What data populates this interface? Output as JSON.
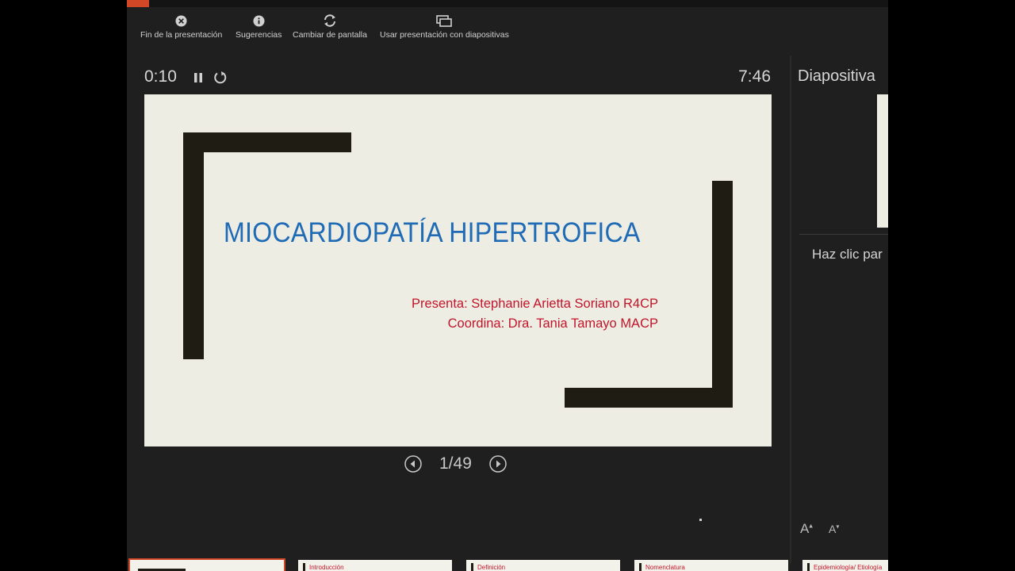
{
  "toolbar": {
    "end": "Fin de la presentación",
    "tips": "Sugerencias",
    "switch": "Cambiar de pantalla",
    "use_slideshow": "Usar presentación con diapositivas"
  },
  "timer": {
    "elapsed": "0:10",
    "clock": "7:46"
  },
  "slide": {
    "title": "MIOCARDIOPATÍA HIPERTROFICA",
    "presenter": "Presenta: Stephanie Arietta Soriano R4CP",
    "coordinator": "Coordina: Dra. Tania Tamayo MACP"
  },
  "nav": {
    "counter": "1/49"
  },
  "notes": {
    "heading": "Diapositiva",
    "placeholder": "Haz clic par"
  },
  "thumbs": [
    {
      "label": ""
    },
    {
      "label": "Introducción"
    },
    {
      "label": "Definición"
    },
    {
      "label": "Nomenclatura"
    },
    {
      "label": "Epidemiología/ Etiología"
    }
  ],
  "colors": {
    "accent": "#d24726",
    "title_blue": "#1f6bb5",
    "subtitle_red": "#c0152a",
    "slide_bg": "#eeede4"
  },
  "icons": [
    "close-circle-icon",
    "info-icon",
    "refresh-icon",
    "windows-icon",
    "pause-icon",
    "restart-icon",
    "prev-icon",
    "next-icon"
  ]
}
